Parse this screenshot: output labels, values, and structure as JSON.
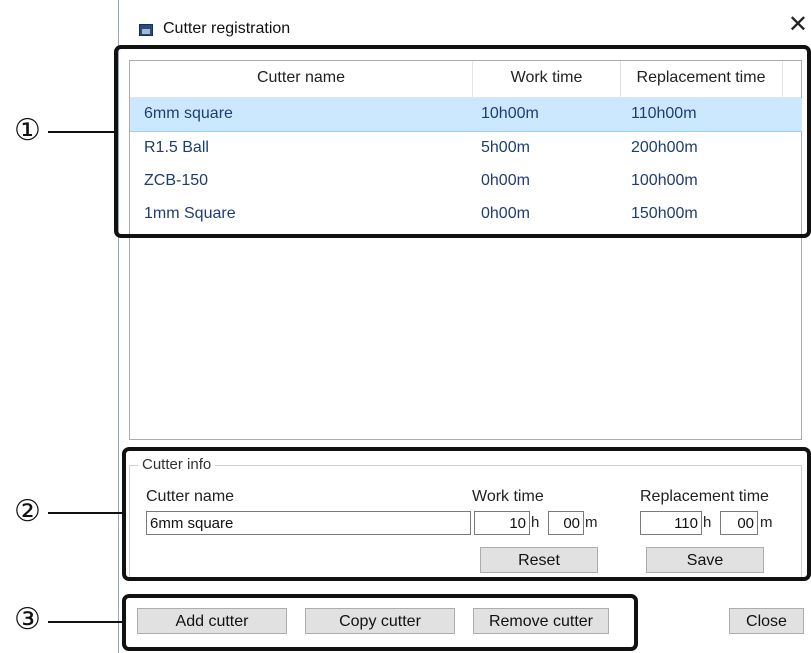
{
  "window": {
    "title": "Cutter registration",
    "close_glyph": "✕"
  },
  "list": {
    "columns": [
      "Cutter name",
      "Work time",
      "Replacement time"
    ],
    "rows": [
      {
        "name": "6mm square",
        "work": "10h00m",
        "replacement": "110h00m",
        "selected": true
      },
      {
        "name": "R1.5 Ball",
        "work": "5h00m",
        "replacement": "200h00m"
      },
      {
        "name": "ZCB-150",
        "work": "0h00m",
        "replacement": "100h00m"
      },
      {
        "name": "1mm Square",
        "work": "0h00m",
        "replacement": "150h00m"
      }
    ]
  },
  "cutter_info": {
    "legend": "Cutter info",
    "name_label": "Cutter name",
    "name_value": "6mm square",
    "work_label": "Work time",
    "work_hours": "10",
    "work_minutes": "00",
    "replacement_label": "Replacement time",
    "replacement_hours": "110",
    "replacement_minutes": "00",
    "hour_unit": "h",
    "minute_unit": "m",
    "reset_label": "Reset",
    "save_label": "Save"
  },
  "footer": {
    "add_label": "Add cutter",
    "copy_label": "Copy cutter",
    "remove_label": "Remove cutter",
    "close_label": "Close"
  },
  "annotations": {
    "marker_1": "①",
    "marker_2": "②",
    "marker_3": "③"
  },
  "colors": {
    "selection": "#cce8ff",
    "link_text": "#1f3d70",
    "button_face": "#e1e1e1"
  }
}
